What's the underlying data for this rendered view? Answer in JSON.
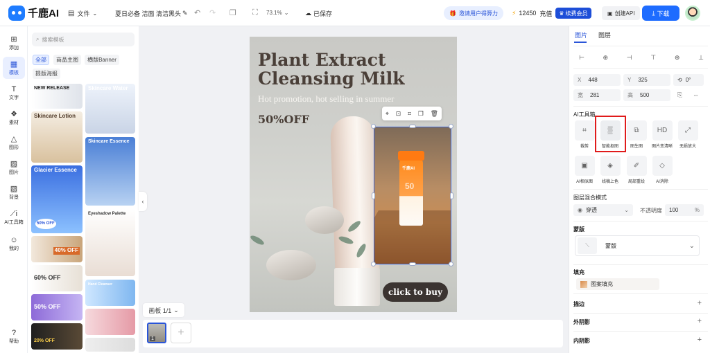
{
  "header": {
    "brand": "千鹿AI",
    "file_menu": "文件",
    "doc_title": "夏日必备 洁面 清洁黑头",
    "zoom": "73.1%",
    "saved": "已保存",
    "invite": "邀请用户得算力",
    "credits": "12450",
    "recharge": "充值",
    "vip": "续费会员",
    "create_api": "创建API",
    "download": "下载"
  },
  "nav": {
    "items": [
      "添加",
      "模板",
      "文字",
      "素材",
      "图形",
      "图片",
      "背景",
      "AI工具箱",
      "我的"
    ],
    "help": "帮助"
  },
  "templates": {
    "search_placeholder": "搜索模板",
    "chips": [
      "全部",
      "商品主图",
      "横版Banner",
      "提版海报"
    ],
    "cards": {
      "new_release": "NEW RELEASE",
      "skincare_lotion": "Skincare Lotion",
      "skincare_water": "Skincare Water",
      "skincare_essence": "Skincare Essence",
      "glacier_essence": "Glacier Essence",
      "off_50": "50% OFF",
      "eyeshadow": "Eyeshadow Palette",
      "off_40": "40% OFF",
      "off_60": "60% OFF",
      "off_50b": "50% OFF",
      "hand_cleanser": "Hand Cleanser",
      "off_20": "20% OFF"
    }
  },
  "canvas": {
    "headline_1": "Plant Extract",
    "headline_2": "Cleansing Milk",
    "subline": "Hot promotion, hot selling in summer",
    "off": "50%OFF",
    "cta": "click to buy",
    "bottle_brand": "千鹿AI",
    "bottle_spf": "50",
    "page_indicator": "画板 1/1",
    "page_number": "1"
  },
  "props": {
    "tabs": [
      "图片",
      "图层"
    ],
    "x_label": "X",
    "x": "448",
    "y_label": "Y",
    "y": "325",
    "rotation": "0°",
    "w_label": "宽",
    "w": "281",
    "h_label": "高",
    "h": "500",
    "ai_toolbox": "AI工具箱",
    "tools": [
      "裁剪",
      "智能抠图",
      "图生图",
      "图片变清晰",
      "无损放大",
      "AI相似图",
      "线稿上色",
      "局部重绘",
      "AI消除"
    ],
    "blend_title": "图层混合模式",
    "blend_value": "穿透",
    "opacity_label": "不透明度",
    "opacity_value": "100",
    "opacity_unit": "%",
    "mask_title": "蒙版",
    "mask_value": "蒙版",
    "fill_title": "填充",
    "fill_value": "图案填充",
    "stroke": "描边",
    "outer_shadow": "外阴影",
    "inner_shadow": "内阴影"
  }
}
